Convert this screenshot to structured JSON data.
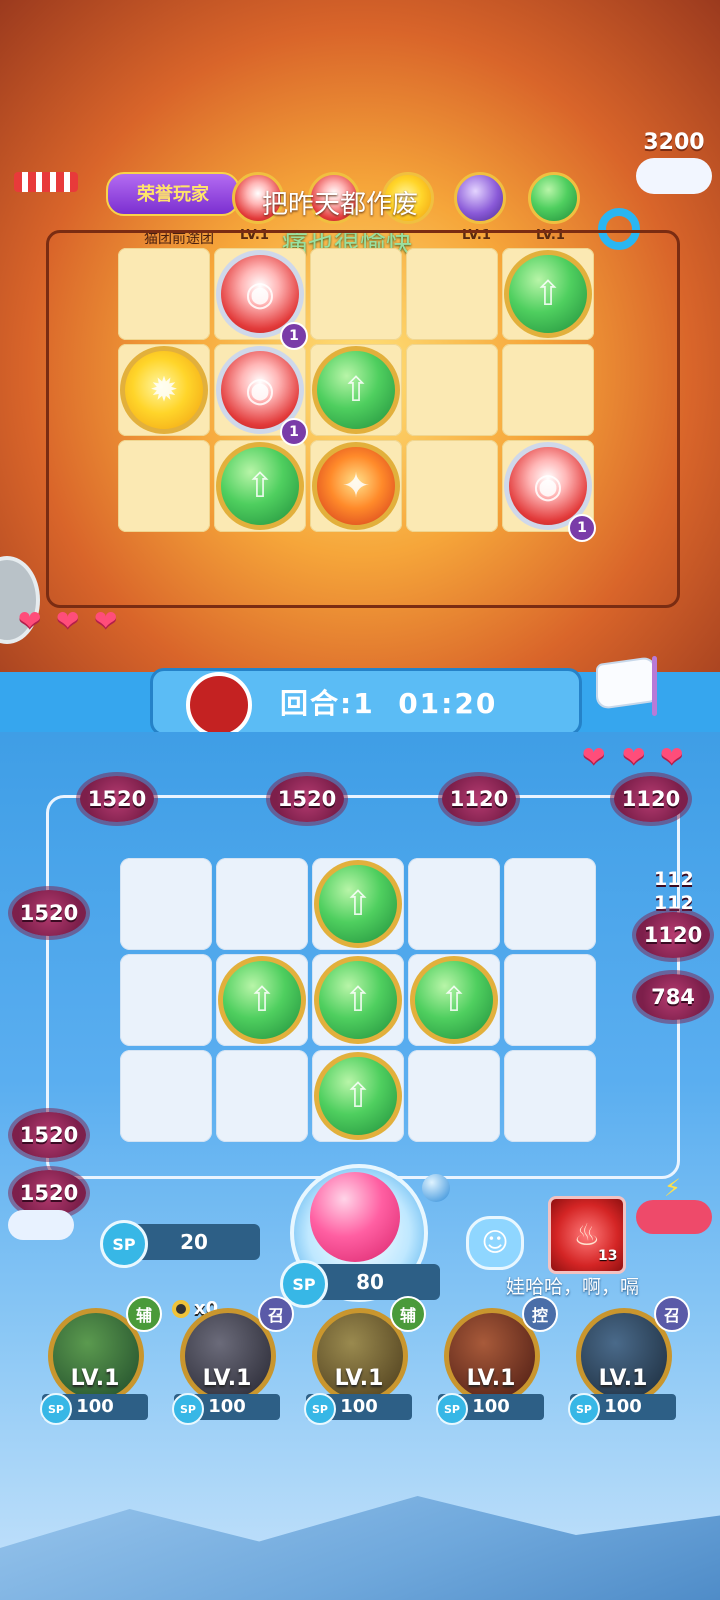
{
  "opponent": {
    "score": "3200",
    "banner": "荣誉玩家",
    "team_name": "猫团前途团",
    "deck": [
      {
        "level": "LV.1",
        "kind": "red-shield"
      },
      {
        "level": "",
        "kind": "red-orb"
      },
      {
        "level": "",
        "kind": "yellow-orb"
      },
      {
        "level": "LV.1",
        "kind": "purple-orb"
      },
      {
        "level": "LV.1",
        "kind": "green-orb"
      }
    ],
    "lyrics": [
      "把昨天都作废",
      "痛也很愉快"
    ],
    "board_badges": [
      "1",
      "1",
      "1"
    ],
    "hearts": 3
  },
  "turn": {
    "label": "回合:1",
    "timer": "01:20"
  },
  "player": {
    "hearts": 3,
    "mines": {
      "top": [
        "1520",
        "1520",
        "1120",
        "1120"
      ],
      "left": [
        "1520",
        "1520",
        "1520"
      ],
      "right": [
        "112",
        "112",
        "1120",
        "784"
      ]
    },
    "sp_current": {
      "label": "SP",
      "value": "20"
    },
    "summon": {
      "label": "SP",
      "value": "80"
    },
    "skill_count": "13",
    "chat_text": "娃哈哈，啊，嗝",
    "coin_count": "x0",
    "heroes": [
      {
        "level": "LV.1",
        "sp": "100",
        "tag": "辅",
        "tag_color": "#4a9a3a",
        "color": "green"
      },
      {
        "level": "LV.1",
        "sp": "100",
        "tag": "召",
        "tag_color": "#5a5aa8",
        "color": "dark"
      },
      {
        "level": "LV.1",
        "sp": "100",
        "tag": "辅",
        "tag_color": "#4a9a3a",
        "color": "yellow"
      },
      {
        "level": "LV.1",
        "sp": "100",
        "tag": "控",
        "tag_color": "#4a6ea8",
        "color": "orange"
      },
      {
        "level": "LV.1",
        "sp": "100",
        "tag": "召",
        "tag_color": "#5a5aa8",
        "color": "blue"
      }
    ]
  }
}
